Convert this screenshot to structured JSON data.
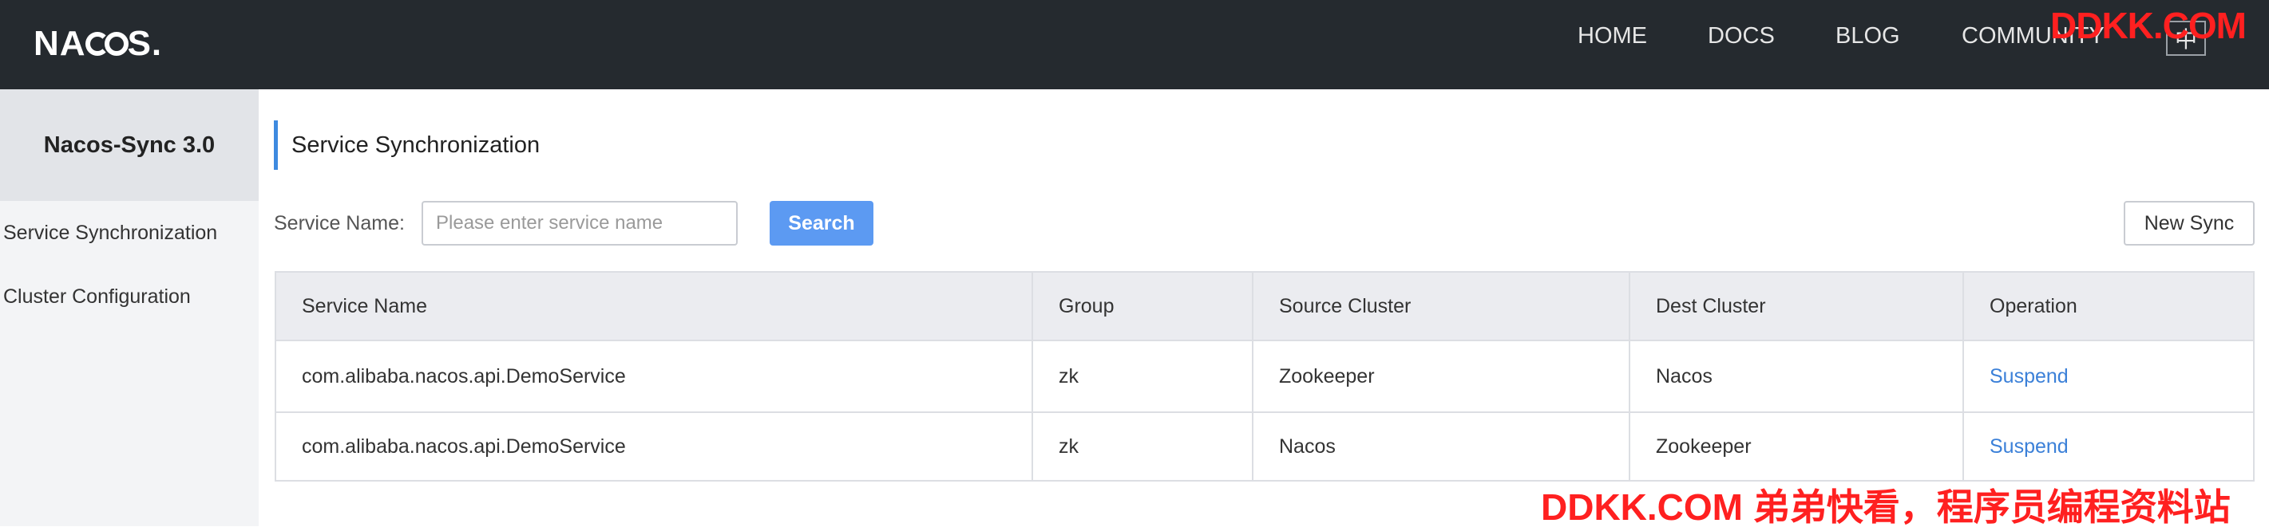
{
  "header": {
    "logo_text": [
      "NA",
      "S."
    ],
    "nav": [
      {
        "label": "HOME"
      },
      {
        "label": "DOCS"
      },
      {
        "label": "BLOG"
      },
      {
        "label": "COMMUNITY"
      }
    ],
    "lang_icon": "language-switch-icon",
    "watermark": "DDKK.COM"
  },
  "sidebar": {
    "title": "Nacos-Sync 3.0",
    "items": [
      {
        "label": "Service Synchronization"
      },
      {
        "label": "Cluster Configuration"
      }
    ]
  },
  "main": {
    "title": "Service Synchronization",
    "search": {
      "label": "Service Name:",
      "placeholder": "Please enter service name",
      "value": "",
      "button": "Search"
    },
    "new_sync_button": "New Sync",
    "table": {
      "columns": [
        "Service Name",
        "Group",
        "Source Cluster",
        "Dest Cluster",
        "Operation"
      ],
      "rows": [
        {
          "service_name": "com.alibaba.nacos.api.DemoService",
          "group": "zk",
          "source": "Zookeeper",
          "dest": "Nacos",
          "operation": "Suspend"
        },
        {
          "service_name": "com.alibaba.nacos.api.DemoService",
          "group": "zk",
          "source": "Nacos",
          "dest": "Zookeeper",
          "operation": "Suspend"
        }
      ]
    }
  },
  "watermark_bottom": "DDKK.COM 弟弟快看，程序员编程资料站",
  "colors": {
    "topbar": "#252a2f",
    "accent": "#5c9af2",
    "link": "#3b80d8",
    "title_bar": "#3e8ae0",
    "watermark": "#ff2020"
  }
}
